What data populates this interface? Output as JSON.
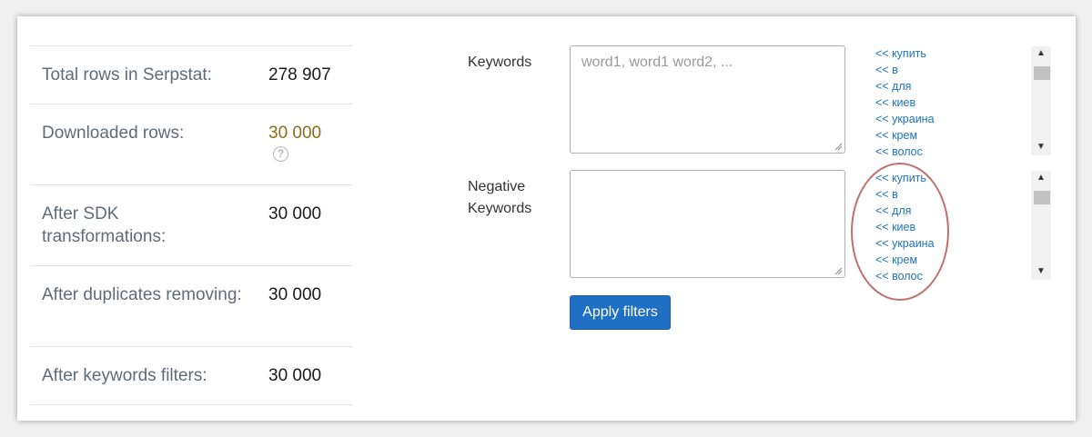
{
  "stats": [
    {
      "label": "Total rows in Serpstat:",
      "value": "278 907"
    },
    {
      "label": "Downloaded rows:",
      "value": "30 000"
    },
    {
      "label": "After SDK transformations:",
      "value": "30 000"
    },
    {
      "label": "After duplicates removing:",
      "value": "30 000"
    },
    {
      "label": "After keywords filters:",
      "value": "30 000"
    }
  ],
  "help_icon": "?",
  "keywords": {
    "label": "Keywords",
    "placeholder": "word1, word1 word2, ...",
    "value": "",
    "suggestions": [
      "<< купить",
      "<< в",
      "<< для",
      "<< киев",
      "<< украина",
      "<< крем",
      "<< волос"
    ]
  },
  "negative_keywords": {
    "label_line1": "Negative",
    "label_line2": "Keywords",
    "value": "",
    "suggestions": [
      "<< купить",
      "<< в",
      "<< для",
      "<< киев",
      "<< украина",
      "<< крем",
      "<< волос"
    ]
  },
  "apply_label": "Apply filters",
  "colors": {
    "accent": "#1f6fc4",
    "link": "#1e73be",
    "highlight_circle": "#c0706f",
    "downloaded_value": "#8a6d1a"
  }
}
